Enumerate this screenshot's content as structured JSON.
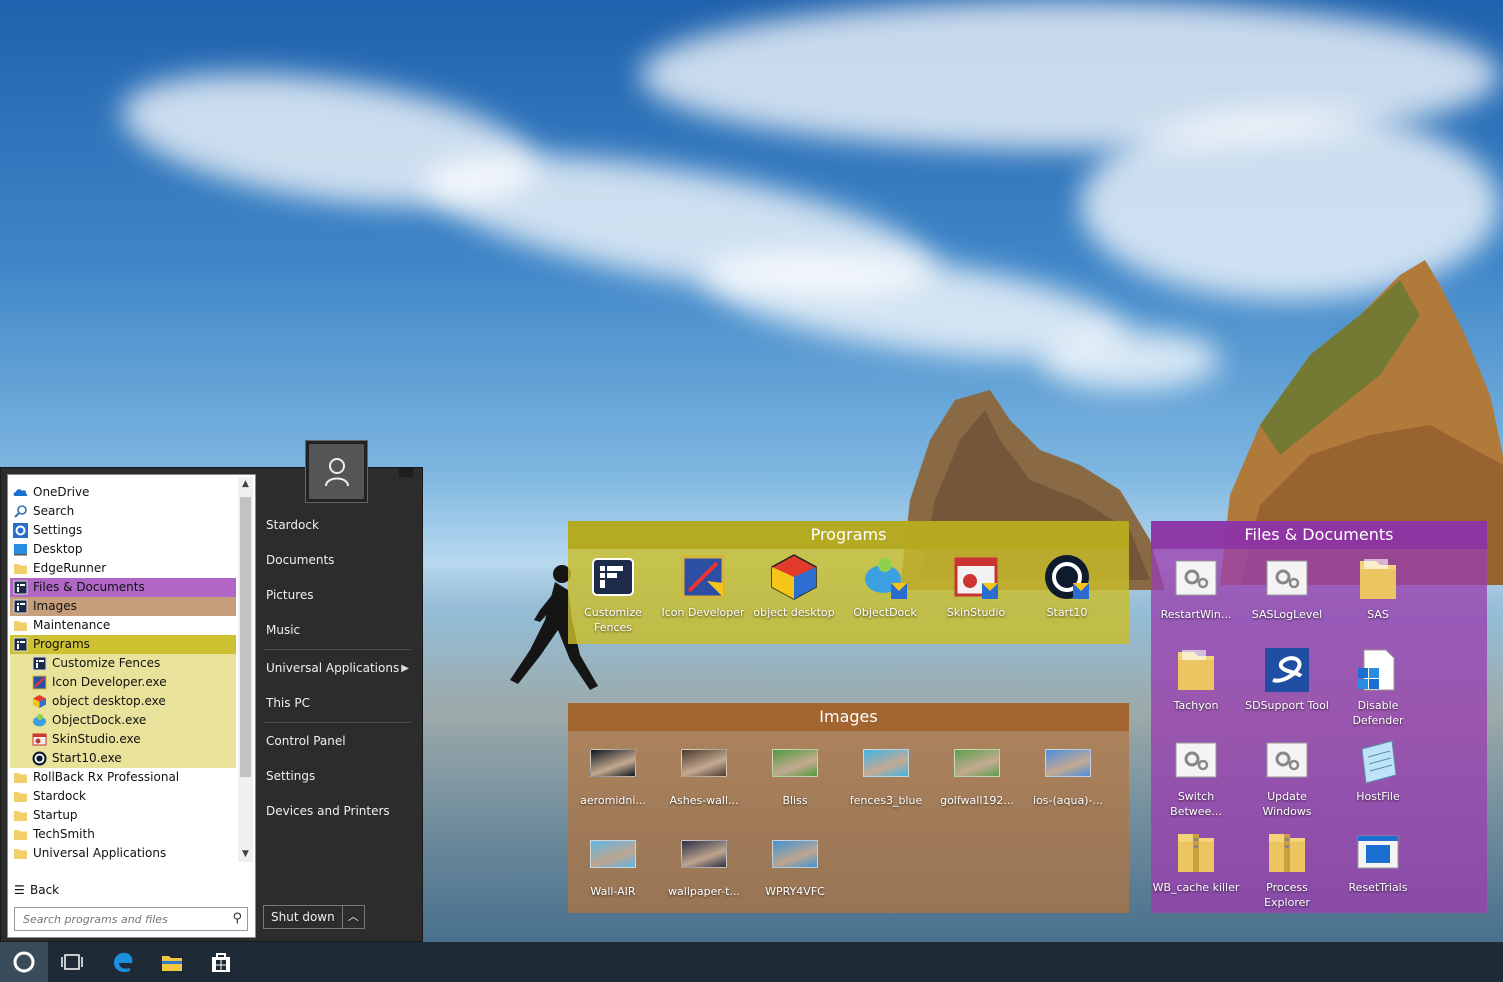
{
  "start_menu": {
    "programs_list": [
      {
        "label": "OneDrive",
        "icon": "onedrive-icon",
        "style": "normal"
      },
      {
        "label": "Search",
        "icon": "search-icon",
        "style": "normal"
      },
      {
        "label": "Settings",
        "icon": "gear-icon",
        "style": "normal"
      },
      {
        "label": "Desktop",
        "icon": "desktop-icon",
        "style": "normal"
      },
      {
        "label": "EdgeRunner",
        "icon": "folder-icon",
        "style": "normal"
      },
      {
        "label": "Files & Documents",
        "icon": "fence-icon",
        "style": "files"
      },
      {
        "label": "Images",
        "icon": "fence-icon",
        "style": "images"
      },
      {
        "label": "Maintenance",
        "icon": "folder-icon",
        "style": "normal"
      },
      {
        "label": "Programs",
        "icon": "fence-icon",
        "style": "programs"
      },
      {
        "label": "Customize Fences",
        "icon": "fence-icon",
        "style": "sub"
      },
      {
        "label": "Icon Developer.exe",
        "icon": "icon-developer-icon",
        "style": "sub"
      },
      {
        "label": "object desktop.exe",
        "icon": "object-desktop-icon",
        "style": "sub"
      },
      {
        "label": "ObjectDock.exe",
        "icon": "objectdock-icon",
        "style": "sub"
      },
      {
        "label": "SkinStudio.exe",
        "icon": "skinstudio-icon",
        "style": "sub"
      },
      {
        "label": "Start10.exe",
        "icon": "start10-icon",
        "style": "sub"
      },
      {
        "label": "RollBack Rx Professional",
        "icon": "folder-icon",
        "style": "normal"
      },
      {
        "label": "Stardock",
        "icon": "folder-icon",
        "style": "normal"
      },
      {
        "label": "Startup",
        "icon": "folder-icon",
        "style": "normal"
      },
      {
        "label": "TechSmith",
        "icon": "folder-icon",
        "style": "normal"
      },
      {
        "label": "Universal Applications",
        "icon": "folder-icon",
        "style": "normal"
      }
    ],
    "back_label": "Back",
    "search_placeholder": "Search programs and files",
    "right_items": [
      "Stardock",
      "Documents",
      "Pictures",
      "Music",
      "Universal Applications",
      "This PC",
      "Control Panel",
      "Settings",
      "Devices and Printers"
    ],
    "shutdown_label": "Shut down"
  },
  "fences": {
    "programs": {
      "title": "Programs",
      "color": "#c9bd2b",
      "items": [
        {
          "label": "Customize Fences",
          "icon": "customize-fences-icon"
        },
        {
          "label": "Icon Developer",
          "icon": "icon-developer-icon"
        },
        {
          "label": "object desktop",
          "icon": "object-desktop-icon"
        },
        {
          "label": "ObjectDock",
          "icon": "objectdock-icon"
        },
        {
          "label": "SkinStudio",
          "icon": "skinstudio-icon"
        },
        {
          "label": "Start10",
          "icon": "start10-icon"
        }
      ]
    },
    "images": {
      "title": "Images",
      "color": "#b4743e",
      "items": [
        {
          "label": "aeromidni...",
          "thumb": "#0d1620"
        },
        {
          "label": "Ashes-wall...",
          "thumb": "#4a3a2c"
        },
        {
          "label": "Bliss",
          "thumb": "#4f9a3c"
        },
        {
          "label": "fences3_blue",
          "thumb": "#3fb5e8"
        },
        {
          "label": "golfwall192...",
          "thumb": "#5aa04c"
        },
        {
          "label": "ios-(aqua)-...",
          "thumb": "#4a8ee0"
        },
        {
          "label": "Wall-AIR",
          "thumb": "#5fb6e6"
        },
        {
          "label": "wallpaper-t...",
          "thumb": "#2a2f45"
        },
        {
          "label": "WPRY4VFC",
          "thumb": "#3f94d8"
        }
      ]
    },
    "files": {
      "title": "Files & Documents",
      "color": "#9a3fb0",
      "items": [
        {
          "label": "RestartWin...",
          "icon": "gears-file-icon"
        },
        {
          "label": "SASLogLevel",
          "icon": "gears-file-icon"
        },
        {
          "label": "SAS",
          "icon": "folder-icon"
        },
        {
          "label": "Tachyon",
          "icon": "folder-icon"
        },
        {
          "label": "SDSupport Tool",
          "icon": "sdsupport-icon"
        },
        {
          "label": "Disable Defender",
          "icon": "script-file-icon"
        },
        {
          "label": "Switch Betwee...",
          "icon": "gears-file-icon"
        },
        {
          "label": "Update Windows",
          "icon": "gears-file-icon"
        },
        {
          "label": "HostFile",
          "icon": "notepad-icon"
        },
        {
          "label": "WB_cache killer",
          "icon": "zip-folder-icon"
        },
        {
          "label": "Process Explorer",
          "icon": "zip-folder-icon"
        },
        {
          "label": "ResetTrials",
          "icon": "window-app-icon"
        }
      ]
    }
  },
  "taskbar": {
    "buttons": [
      "start10-orb-icon",
      "task-view-icon",
      "edge-icon",
      "file-explorer-icon",
      "store-icon"
    ]
  }
}
